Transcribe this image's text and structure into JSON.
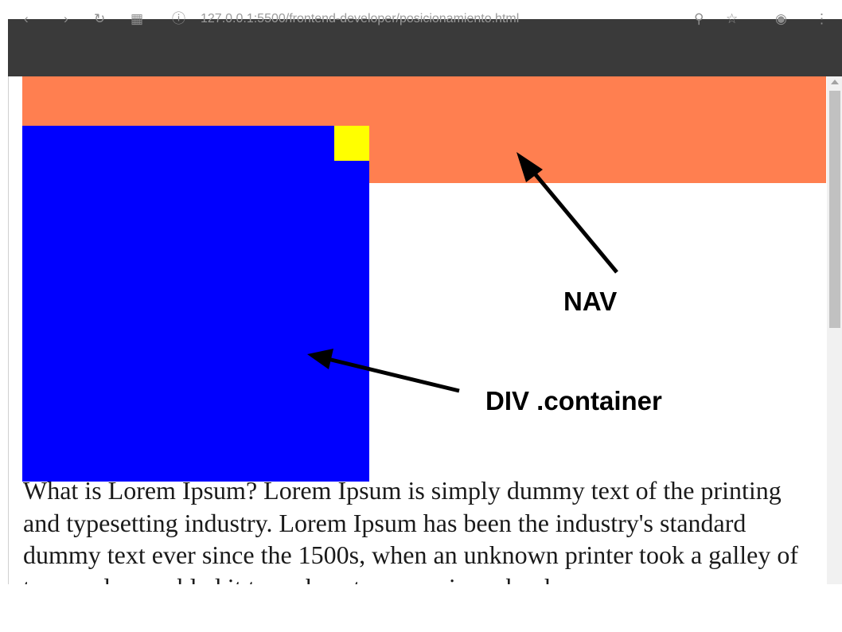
{
  "browser": {
    "back_icon": "back-arrow-icon",
    "forward_icon": "forward-arrow-icon",
    "reload_icon": "reload-icon",
    "apps_icon": "apps-icon",
    "info_icon": "info-icon",
    "url": "127.0.0.1:5500/frontend-developer/posicionamiento.html",
    "search_icon": "search-icon",
    "bookmark_icon": "star-icon",
    "extension_icon": "extension-icon",
    "menu_icon": "kebab-menu-icon",
    "chrome_color": "#3a3a3a"
  },
  "page": {
    "nav_color": "#ff7f50",
    "container_color": "#0000ff",
    "square_color": "#ffff00",
    "paragraph": "What is Lorem Ipsum? Lorem Ipsum is simply dummy text of the printing and typesetting industry. Lorem Ipsum has been the industry's standard dummy text ever since the 1500s, when an unknown printer took a galley of type and scrambled it to make a type specimen book."
  },
  "annotations": {
    "nav_label": "NAV",
    "container_label": "DIV .container"
  }
}
